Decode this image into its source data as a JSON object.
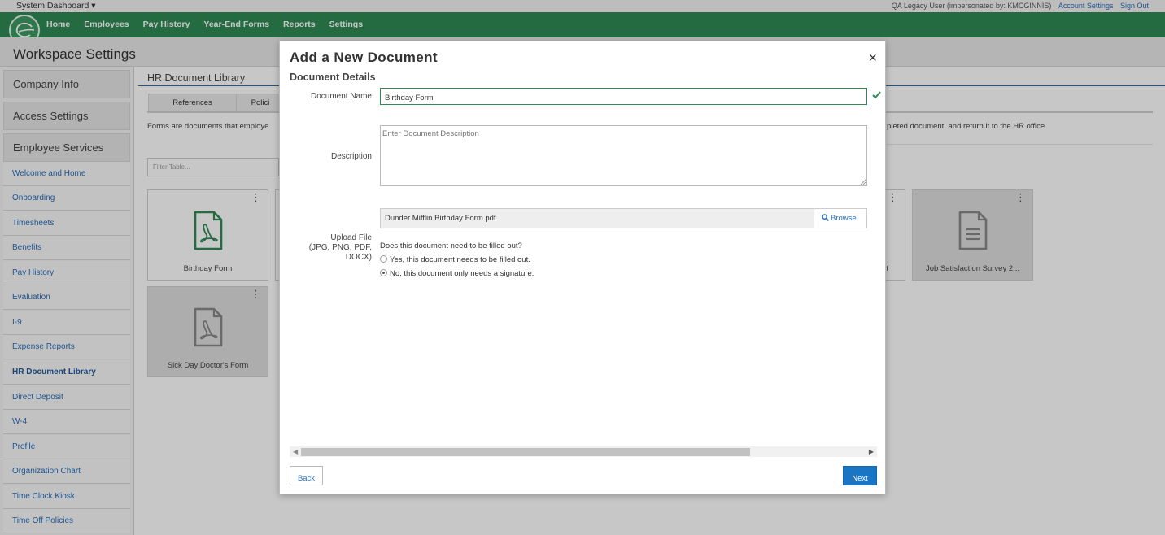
{
  "topbar": {
    "system_dashboard": "System Dashboard ▾",
    "user_info": "QA Legacy User (impersonated by: KMCGINNIS)",
    "account_settings": "Account Settings",
    "sign_out": "Sign Out"
  },
  "navbar": {
    "items": [
      "Home",
      "Employees",
      "Pay History",
      "Year-End Forms",
      "Reports",
      "Settings"
    ]
  },
  "workspace": {
    "title": "Workspace Settings"
  },
  "sidebar": {
    "sections": [
      "Company Info",
      "Access Settings",
      "Employee Services"
    ],
    "links": [
      "Welcome and Home",
      "Onboarding",
      "Timesheets",
      "Benefits",
      "Pay History",
      "Evaluation",
      "I-9",
      "Expense Reports",
      "HR Document Library",
      "Direct Deposit",
      "W-4",
      "Profile",
      "Organization Chart",
      "Time Clock Kiosk",
      "Time Off Policies"
    ],
    "active_link": "HR Document Library"
  },
  "main": {
    "title": "HR Document Library",
    "tabs": [
      "References",
      "Polici"
    ],
    "intro_left": "Forms are documents that employe",
    "intro_right": "pleted document, and return it to the HR office.",
    "filter_placeholder": "Filter Table...",
    "cards": [
      {
        "label": "Birthday Form",
        "icon": "pdf-icon",
        "icon_color": "#2f8a55"
      },
      {
        "label": "t",
        "icon": "none"
      },
      {
        "label": "Job Satisfaction Survey 2...",
        "icon": "document-icon"
      },
      {
        "label": "Sick Day Doctor's Form",
        "icon": "pdf-icon"
      }
    ],
    "menu_glyph": "⋮"
  },
  "modal": {
    "title": "Add a New Document",
    "close_glyph": "×",
    "subtitle": "Document Details",
    "doc_name_label": "Document Name",
    "doc_name_value": "Birthday Form",
    "description_label": "Description",
    "description_placeholder": "Enter Document Description",
    "upload_label_1": "Upload File",
    "upload_label_2": "(JPG, PNG, PDF,",
    "upload_label_3": "DOCX)",
    "file_name": "Dunder Mifflin Birthday Form.pdf",
    "browse_label": "Browse",
    "question": "Does this document need to be filled out?",
    "option_yes": "Yes, this document needs to be filled out.",
    "option_no": "No, this document only needs a signature.",
    "selected_option": "no",
    "back_label": "Back",
    "next_label": "Next"
  },
  "colors": {
    "brand_green": "#2f8a55",
    "link_blue": "#2a6ebb",
    "primary_button": "#1a76c4"
  }
}
